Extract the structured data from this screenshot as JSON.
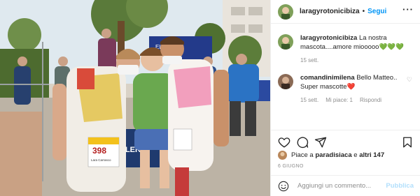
{
  "post": {
    "username": "laragyrotonicibiza",
    "follow_label": "Segui",
    "more_icon": "more-dots-icon",
    "caption": {
      "username": "laragyrotonicibiza",
      "text": "La nostra mascota....amore miooooo💚💚💚",
      "time": "15 sett."
    },
    "comments": [
      {
        "username": "comandinimilena",
        "text": "Bello Matteo.. Super mascotte❤️",
        "time": "15 sett.",
        "likes": "Mi piace: 1",
        "reply": "Rispondi"
      }
    ],
    "likes": {
      "prefix": "Piace a",
      "user": "paradisiaca",
      "connector": "e",
      "others": "altri 147"
    },
    "date": "6 GIUGNO",
    "add_comment_placeholder": "Aggiungi un commento...",
    "publish_label": "Pubblica",
    "photo": {
      "bib_number": "398",
      "bib_name": "Lara Carrasco",
      "banner_text": "MILLER",
      "banner_small": "ELICA"
    }
  },
  "colors": {
    "accent": "#0095f6",
    "publish_disabled": "#b2dffc",
    "muted": "#8e8e8e",
    "heart_red": "#ed4956"
  }
}
